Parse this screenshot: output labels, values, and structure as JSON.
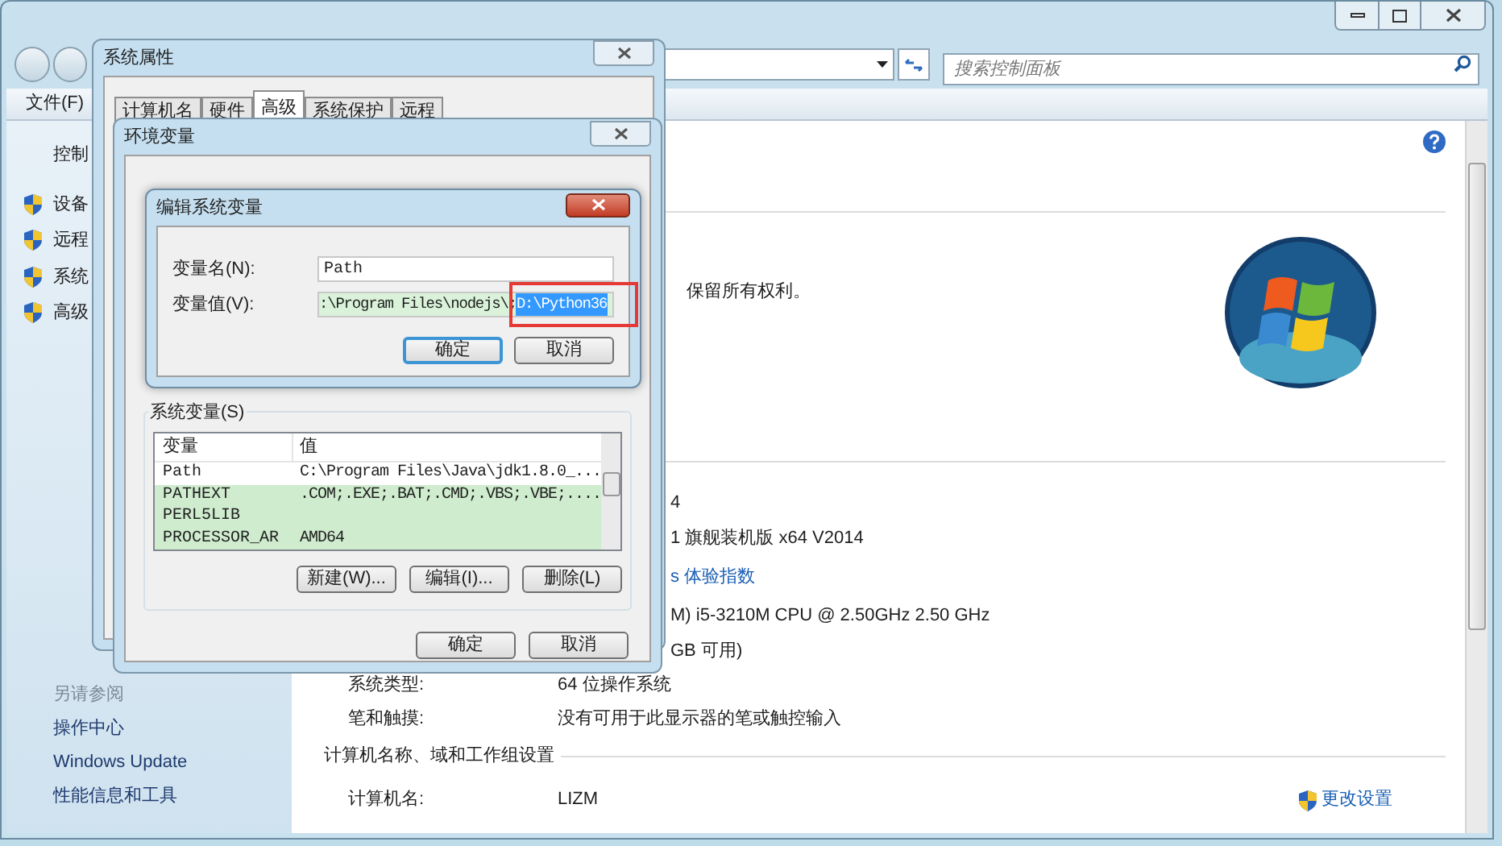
{
  "window": {
    "search": {
      "placeholder": "搜索控制面板"
    },
    "menu": [
      "文件(F)"
    ]
  },
  "sidebar": {
    "home": "控制",
    "items": [
      "设备",
      "远程",
      "系统",
      "高级"
    ],
    "see_also": {
      "title": "另请参阅",
      "links": [
        "操作中心",
        "Windows Update",
        "性能信息和工具"
      ]
    }
  },
  "content": {
    "copyright": "保留所有权利。",
    "rows": [
      {
        "kind": "partial",
        "value": "4"
      },
      {
        "kind": "partial",
        "value": "1 旗舰装机版 x64 V2014"
      },
      {
        "kind": "link",
        "value": "s 体验指数"
      },
      {
        "kind": "partial",
        "value": "M) i5-3210M CPU @ 2.50GHz   2.50 GHz"
      },
      {
        "kind": "partial",
        "value": "GB 可用)"
      },
      {
        "kind": "pair",
        "label": "系统类型:",
        "value": "64 位操作系统"
      },
      {
        "kind": "pair",
        "label": "笔和触摸:",
        "value": "没有可用于此显示器的笔或触控输入"
      }
    ],
    "section": "计算机名称、域和工作组设置",
    "computer_rows": [
      {
        "label": "计算机名:",
        "value": "LIZM"
      }
    ],
    "change_settings": "更改设置"
  },
  "system_properties": {
    "title": "系统属性",
    "tabs": [
      {
        "label": "计算机名",
        "selected": false
      },
      {
        "label": "硬件",
        "selected": false
      },
      {
        "label": "高级",
        "selected": true
      },
      {
        "label": "系统保护",
        "selected": false
      },
      {
        "label": "远程",
        "selected": false
      }
    ]
  },
  "env_dialog": {
    "title": "环境变量",
    "group": "系统变量(S)",
    "columns": [
      "变量",
      "值"
    ],
    "rows": [
      {
        "name": "Path",
        "value": "C:\\Program Files\\Java\\jdk1.8.0_...",
        "highlighted": false
      },
      {
        "name": "PATHEXT",
        "value": ".COM;.EXE;.BAT;.CMD;.VBS;.VBE;....",
        "highlighted": true
      },
      {
        "name": "PERL5LIB",
        "highlighted": true
      },
      {
        "name": "PROCESSOR_AR",
        "value": "AMD64",
        "highlighted": true
      }
    ],
    "list_buttons": [
      "新建(W)...",
      "编辑(I)...",
      "删除(L)"
    ],
    "buttons": [
      "确定",
      "取消"
    ]
  },
  "edit_dialog": {
    "title": "编辑系统变量",
    "name_label": "变量名(N):",
    "name_value": "Path",
    "value_label": "变量值(V):",
    "value_text": ":\\Program Files\\nodejs\\;",
    "value_selected": "D:\\Python36",
    "buttons": [
      {
        "label": "确定",
        "default": true
      },
      {
        "label": "取消",
        "default": false
      }
    ]
  }
}
